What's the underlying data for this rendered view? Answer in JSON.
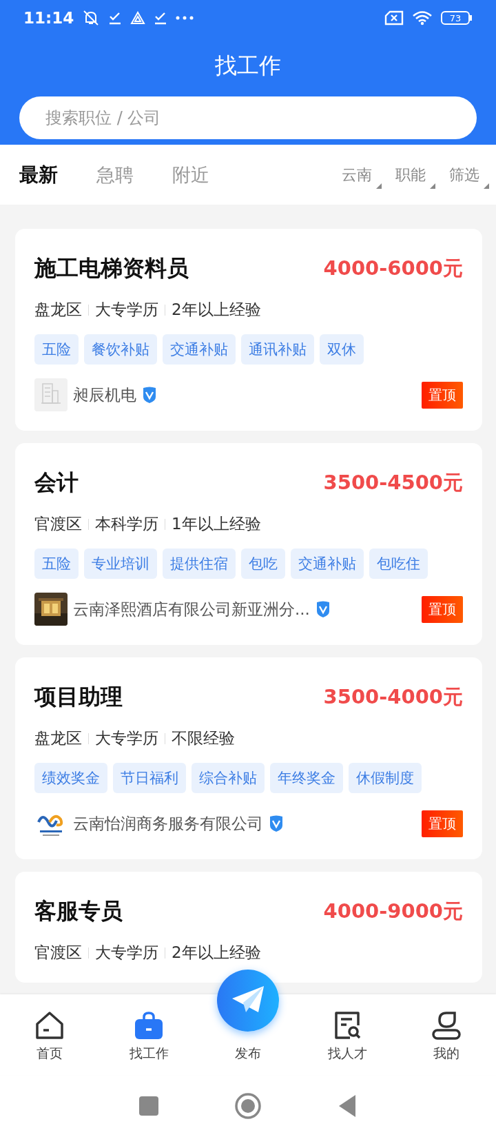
{
  "status_bar": {
    "time": "11:14",
    "battery": "73"
  },
  "header": {
    "title": "找工作",
    "search": {
      "placeholder": "搜索职位 / 公司"
    }
  },
  "tabs": [
    {
      "label": "最新",
      "selected": true
    },
    {
      "label": "急聘",
      "selected": false
    },
    {
      "label": "附近",
      "selected": false
    }
  ],
  "filters": [
    "云南",
    "职能",
    "筛选"
  ],
  "jobs": [
    {
      "title": "施工电梯资料员",
      "salary": "4000-6000元",
      "meta": [
        "盘龙区",
        "大专学历",
        "2年以上经验"
      ],
      "tags": [
        "五险",
        "餐饮补贴",
        "交通补贴",
        "通讯补贴",
        "双休"
      ],
      "company": "昶辰机电",
      "logo": {
        "kind": "placeholder"
      },
      "verified": true,
      "badge": "置顶"
    },
    {
      "title": "会计",
      "salary": "3500-4500元",
      "meta": [
        "官渡区",
        "本科学历",
        "1年以上经验"
      ],
      "tags": [
        "五险",
        "专业培训",
        "提供住宿",
        "包吃",
        "交通补贴",
        "包吃住"
      ],
      "company": "云南泽熙酒店有限公司新亚洲分...",
      "logo": {
        "kind": "picture"
      },
      "verified": true,
      "badge": "置顶"
    },
    {
      "title": "项目助理",
      "salary": "3500-4000元",
      "meta": [
        "盘龙区",
        "大专学历",
        "不限经验"
      ],
      "tags": [
        "绩效奖金",
        "节日福利",
        "综合补贴",
        "年终奖金",
        "休假制度"
      ],
      "company": "云南怡润商务服务有限公司",
      "logo": {
        "kind": "mark"
      },
      "verified": true,
      "badge": "置顶"
    },
    {
      "title": "客服专员",
      "salary": "4000-9000元",
      "meta": [
        "官渡区",
        "大专学历",
        "2年以上经验"
      ]
    }
  ],
  "bottom_nav": [
    {
      "label": "首页",
      "kind": "home",
      "selected": false
    },
    {
      "label": "找工作",
      "kind": "bag",
      "selected": true
    },
    {
      "label": "发布",
      "kind": "publish",
      "selected": false
    },
    {
      "label": "找人才",
      "kind": "resume",
      "selected": false
    },
    {
      "label": "我的",
      "kind": "user",
      "selected": false
    }
  ]
}
